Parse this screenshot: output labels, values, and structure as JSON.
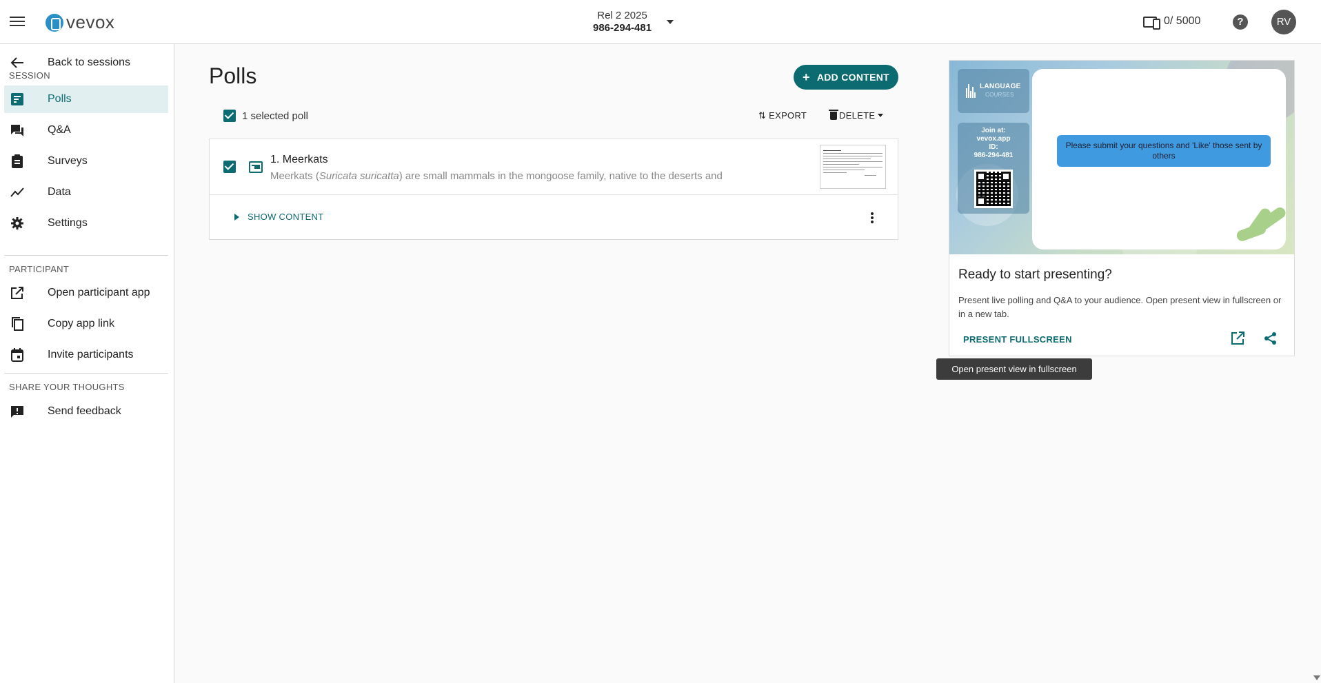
{
  "app": {
    "logo_text": "vevox"
  },
  "header": {
    "session_name": "Rel 2 2025",
    "session_id": "986-294-481",
    "participants": "0/ 5000",
    "help_label": "?",
    "avatar_initials": "RV"
  },
  "sidebar": {
    "back_label": "Back to sessions",
    "session_section": "SESSION",
    "session_items": [
      {
        "label": "Polls",
        "icon": "polls-icon",
        "active": true
      },
      {
        "label": "Q&A",
        "icon": "qa-icon"
      },
      {
        "label": "Surveys",
        "icon": "surveys-icon"
      },
      {
        "label": "Data",
        "icon": "data-icon"
      },
      {
        "label": "Settings",
        "icon": "gear-icon"
      }
    ],
    "participant_section": "PARTICIPANT",
    "participant_items": [
      {
        "label": "Open participant app",
        "icon": "open-external-icon"
      },
      {
        "label": "Copy app link",
        "icon": "copy-icon"
      },
      {
        "label": "Invite participants",
        "icon": "calendar-icon"
      }
    ],
    "feedback_section": "SHARE YOUR THOUGHTS",
    "feedback_items": [
      {
        "label": "Send feedback",
        "icon": "feedback-icon"
      }
    ]
  },
  "main": {
    "title": "Polls",
    "add_content_label": "ADD CONTENT",
    "selected_label": "1 selected poll",
    "export_label": "EXPORT",
    "delete_label": "DELETE",
    "poll": {
      "title": "1. Meerkats",
      "desc_prefix": "Meerkats (",
      "desc_italic": "Suricata suricatta",
      "desc_suffix": ") are small mammals in the mongoose family, native to the deserts and",
      "show_content_label": "SHOW CONTENT"
    }
  },
  "present": {
    "brand_title": "LANGUAGE",
    "brand_sub": "COURSES",
    "join_at_label": "Join at:",
    "join_url": "vevox.app",
    "id_label": "ID:",
    "id_value": "986-294-481",
    "slide_message": "Please submit your questions and 'Like' those sent by others",
    "ready_title": "Ready to start presenting?",
    "ready_desc": "Present live polling and Q&A to your audience. Open present view in fullscreen or in a new tab.",
    "present_fullscreen_label": "PRESENT FULLSCREEN",
    "tooltip": "Open present view in fullscreen"
  },
  "colors": {
    "accent": "#0b6b71",
    "active_bg": "#e1eff0",
    "slide_message_bg": "#3f9ae0"
  }
}
